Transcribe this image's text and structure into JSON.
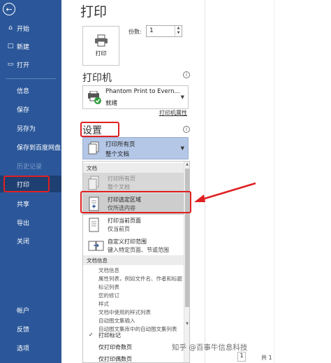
{
  "sidebar": {
    "back_icon": "back-arrow-icon",
    "items_top": [
      {
        "icon": "home-icon",
        "label": "开始"
      },
      {
        "icon": "new-doc-icon",
        "label": "新建"
      },
      {
        "icon": "open-folder-icon",
        "label": "打开"
      }
    ],
    "items_mid": [
      "信息",
      "保存",
      "另存为",
      "保存到百度网盘",
      "历史记录",
      "打印",
      "共享",
      "导出",
      "关闭"
    ],
    "items_bottom": [
      "帐户",
      "反馈",
      "选项"
    ],
    "active": "打印",
    "color": "#2b579a"
  },
  "main": {
    "title": "打印",
    "print_button_label": "打印",
    "copies_label": "份数:",
    "copies_value": "1",
    "printer_heading": "打印机",
    "printer_name": "Phantom Print to Evern...",
    "printer_status": "就绪",
    "printer_props_link": "打印机属性",
    "settings_heading": "设置",
    "setting_line1": "打印所有页",
    "setting_line2": "整个文档"
  },
  "dropdown": {
    "group_doc": "文档",
    "items": [
      {
        "line1": "打印所有页",
        "line2": "整个文档"
      },
      {
        "line1": "打印选定区域",
        "line2": "仅所选内容"
      },
      {
        "line1": "打印当前页面",
        "line2": "仅当前页"
      },
      {
        "line1": "自定义打印范围",
        "line2": "键入特定页面、节或范围"
      }
    ],
    "group_info": "文档信息",
    "info_items": [
      "文档信息",
      "属性列表，例如文件名、作者和标题",
      "标记列表",
      "您的修订",
      "样式",
      "文档中使用的样式列表",
      "自动图文集输入",
      "自动图文集库中的自动图文集列表"
    ],
    "options": [
      {
        "label": "打印标记",
        "checked": true
      },
      {
        "label": "仅打印奇数页",
        "checked": false
      },
      {
        "label": "仅打印偶数页",
        "checked": false
      }
    ]
  },
  "overlay": {
    "watermark": "知乎 @百事牛信息科技",
    "page_number": "1",
    "page_of": "共 1",
    "highlight_color": "#e02020"
  }
}
